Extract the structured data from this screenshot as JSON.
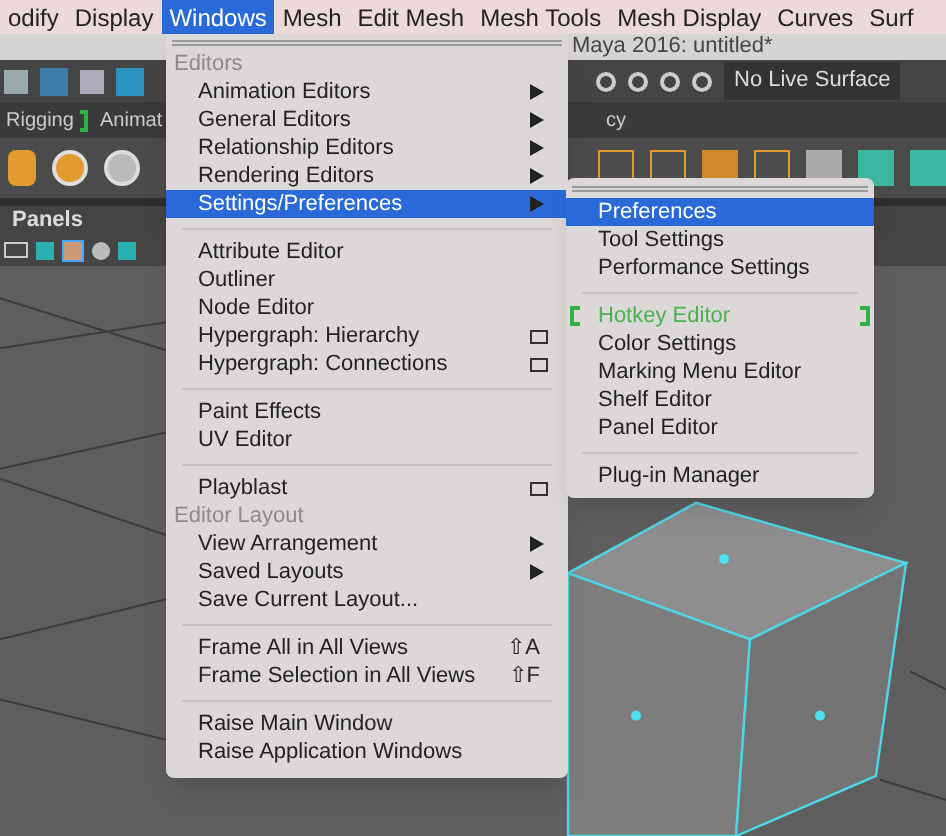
{
  "menubar": [
    {
      "label": "odify",
      "selected": false
    },
    {
      "label": "Display",
      "selected": false
    },
    {
      "label": "Windows",
      "selected": true
    },
    {
      "label": "Mesh",
      "selected": false
    },
    {
      "label": "Edit Mesh",
      "selected": false
    },
    {
      "label": "Mesh Tools",
      "selected": false
    },
    {
      "label": "Mesh Display",
      "selected": false
    },
    {
      "label": "Curves",
      "selected": false
    },
    {
      "label": "Surf",
      "selected": false
    }
  ],
  "window": {
    "title": "Maya 2016: untitled*"
  },
  "toolbar": {
    "live_surface": "No Live Surface"
  },
  "shelf_tabs": [
    {
      "label": "Rigging",
      "marked": true
    },
    {
      "label": "Animat",
      "marked": false
    },
    {
      "label": "cy",
      "marked": false
    }
  ],
  "panels": {
    "label": "Panels"
  },
  "windows_menu": [
    {
      "kind": "header",
      "label": "Editors"
    },
    {
      "kind": "item",
      "label": "Animation Editors",
      "submenu": true,
      "option_box": false,
      "selected": false
    },
    {
      "kind": "item",
      "label": "General Editors",
      "submenu": true,
      "option_box": false,
      "selected": false
    },
    {
      "kind": "item",
      "label": "Relationship Editors",
      "submenu": true,
      "option_box": false,
      "selected": false
    },
    {
      "kind": "item",
      "label": "Rendering Editors",
      "submenu": true,
      "option_box": false,
      "selected": false
    },
    {
      "kind": "item",
      "label": "Settings/Preferences",
      "submenu": true,
      "option_box": false,
      "selected": true
    },
    {
      "kind": "separator"
    },
    {
      "kind": "item",
      "label": "Attribute Editor",
      "submenu": false,
      "option_box": false,
      "selected": false
    },
    {
      "kind": "item",
      "label": "Outliner",
      "submenu": false,
      "option_box": false,
      "selected": false
    },
    {
      "kind": "item",
      "label": "Node Editor",
      "submenu": false,
      "option_box": false,
      "selected": false
    },
    {
      "kind": "item",
      "label": "Hypergraph: Hierarchy",
      "submenu": false,
      "option_box": true,
      "selected": false
    },
    {
      "kind": "item",
      "label": "Hypergraph: Connections",
      "submenu": false,
      "option_box": true,
      "selected": false
    },
    {
      "kind": "separator"
    },
    {
      "kind": "item",
      "label": "Paint Effects",
      "submenu": false,
      "option_box": false,
      "selected": false
    },
    {
      "kind": "item",
      "label": "UV Editor",
      "submenu": false,
      "option_box": false,
      "selected": false
    },
    {
      "kind": "separator"
    },
    {
      "kind": "item",
      "label": "Playblast",
      "submenu": false,
      "option_box": true,
      "selected": false
    },
    {
      "kind": "header",
      "label": "Editor Layout"
    },
    {
      "kind": "item",
      "label": "View Arrangement",
      "submenu": true,
      "option_box": false,
      "selected": false
    },
    {
      "kind": "item",
      "label": "Saved Layouts",
      "submenu": true,
      "option_box": false,
      "selected": false
    },
    {
      "kind": "item",
      "label": "Save Current Layout...",
      "submenu": false,
      "option_box": false,
      "selected": false
    },
    {
      "kind": "separator"
    },
    {
      "kind": "item",
      "label": "Frame All in All Views",
      "shortcut": "⇧A",
      "submenu": false,
      "option_box": false,
      "selected": false
    },
    {
      "kind": "item",
      "label": "Frame Selection in All Views",
      "shortcut": "⇧F",
      "submenu": false,
      "option_box": false,
      "selected": false
    },
    {
      "kind": "separator"
    },
    {
      "kind": "item",
      "label": "Raise Main Window",
      "submenu": false,
      "option_box": false,
      "selected": false
    },
    {
      "kind": "item",
      "label": "Raise Application Windows",
      "submenu": false,
      "option_box": false,
      "selected": false
    }
  ],
  "settings_submenu": [
    {
      "kind": "item",
      "label": "Preferences",
      "selected": true
    },
    {
      "kind": "item",
      "label": "Tool Settings",
      "selected": false
    },
    {
      "kind": "item",
      "label": "Performance Settings",
      "selected": false
    },
    {
      "kind": "separator"
    },
    {
      "kind": "highlight",
      "label": "Hotkey Editor",
      "selected": false
    },
    {
      "kind": "item",
      "label": "Color Settings",
      "selected": false
    },
    {
      "kind": "item",
      "label": "Marking Menu Editor",
      "selected": false
    },
    {
      "kind": "item",
      "label": "Shelf Editor",
      "selected": false
    },
    {
      "kind": "item",
      "label": "Panel Editor",
      "selected": false
    },
    {
      "kind": "separator"
    },
    {
      "kind": "item",
      "label": "Plug-in Manager",
      "selected": false
    }
  ]
}
